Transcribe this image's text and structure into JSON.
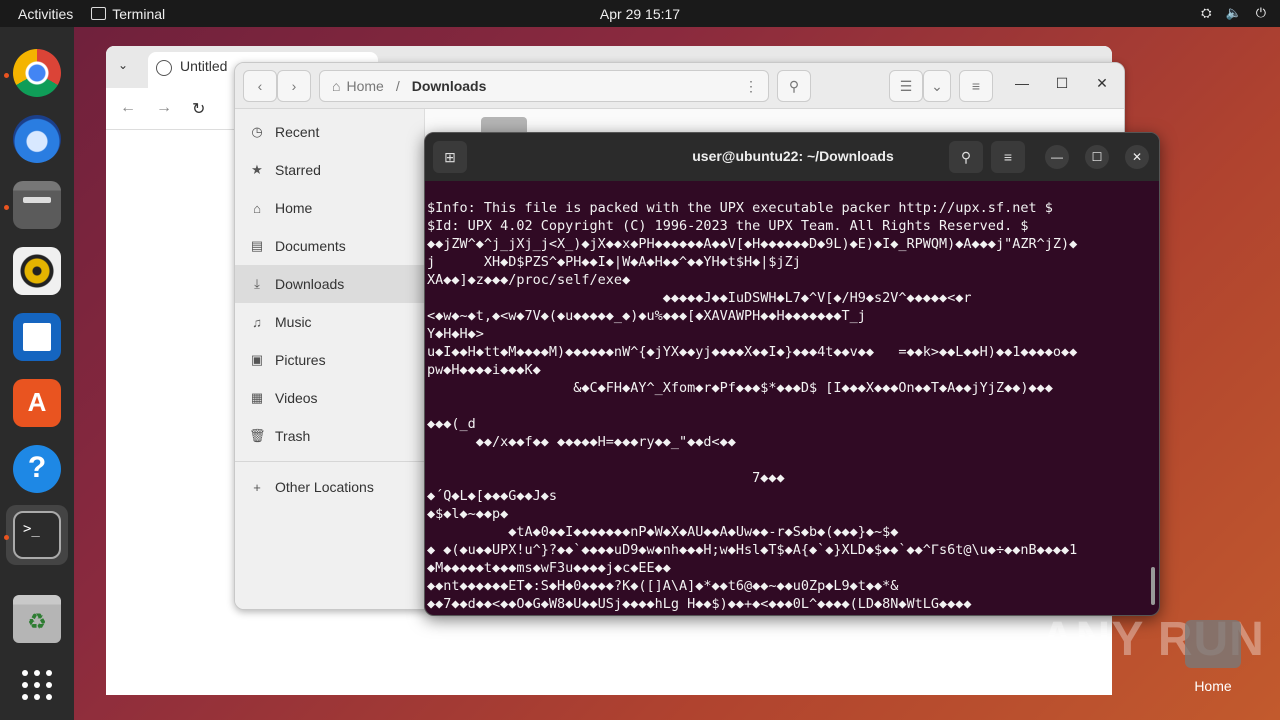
{
  "topbar": {
    "activities": "Activities",
    "app_name": "Terminal",
    "clock": "Apr 29  15:17"
  },
  "dock": {
    "items": [
      "Google Chrome",
      "Thunderbird",
      "Files",
      "Rhythmbox",
      "LibreOffice Writer",
      "Ubuntu Software",
      "Help",
      "Terminal",
      "Trash",
      "Show Applications"
    ]
  },
  "browser": {
    "tab_title": "Untitled"
  },
  "files": {
    "path_home": "Home",
    "path_sep": "/",
    "path_current": "Downloads",
    "sidebar": [
      {
        "label": "Recent",
        "icon": "clock-icon"
      },
      {
        "label": "Starred",
        "icon": "star-icon"
      },
      {
        "label": "Home",
        "icon": "home-icon"
      },
      {
        "label": "Documents",
        "icon": "document-icon"
      },
      {
        "label": "Downloads",
        "icon": "download-icon"
      },
      {
        "label": "Music",
        "icon": "music-icon"
      },
      {
        "label": "Pictures",
        "icon": "picture-icon"
      },
      {
        "label": "Videos",
        "icon": "video-icon"
      },
      {
        "label": "Trash",
        "icon": "trash-icon"
      }
    ],
    "other_locations": "Other Locations"
  },
  "terminal": {
    "title": "user@ubuntu22: ~/Downloads",
    "lines": [
      "$Info: This file is packed with the UPX executable packer http://upx.sf.net $",
      "$Id: UPX 4.02 Copyright (C) 1996-2023 the UPX Team. All Rights Reserved. $",
      "◆◆jZW^◆^j_jXj_j<X_)◆jX◆◆x◆PH◆◆◆◆◆◆A◆◆V[◆H◆◆◆◆◆◆D◆9L)◆E)◆I◆_RPWQM)◆A◆◆◆j\"AZR^jZ)◆",
      "j      XH◆D$PZS^◆PH◆◆I◆|W◆A◆H◆◆^◆◆YH◆t$H◆|$jZj",
      "XA◆◆]◆z◆◆◆/proc/self/exe◆",
      "                             ◆◆◆◆◆J◆◆IuDSWH◆L7◆^V[◆/H9◆s2V^◆◆◆◆◆<◆r",
      "<◆w◆~◆t,◆<w◆7V◆(◆u◆◆◆◆◆_◆)◆u%◆◆◆[◆XAVAWPH◆◆H◆◆◆◆◆◆◆T_j",
      "Y◆H◆H◆>",
      "u◆I◆◆H◆tt◆M◆◆◆◆M)◆◆◆◆◆◆nW^{◆jYX◆◆yj◆◆◆◆X◆◆I◆}◆◆◆4t◆◆v◆◆   =◆◆k>◆◆L◆◆H)◆◆1◆◆◆◆o◆◆",
      "pw◆H◆◆◆◆i◆◆◆K◆",
      "                  &◆C◆FH◆AY^_Xfom◆r◆Pf◆◆◆$*◆◆◆D$ [I◆◆◆X◆◆◆On◆◆T◆A◆◆jYjZ◆◆)◆◆◆",
      "",
      "◆◆◆(_d",
      "      ◆◆/x◆◆f◆◆ ◆◆◆◆◆H=◆◆◆ry◆◆_\"◆◆d<◆◆",
      "",
      "                                        7◆◆◆",
      "◆´Q◆L◆[◆◆◆G◆◆J◆s",
      "◆$◆l◆~◆◆p◆",
      "          ◆tA◆0◆◆I◆◆◆◆◆◆◆nP◆W◆X◆AU◆◆A◆Uw◆◆-r◆S◆b◆(◆◆◆}◆~$◆",
      "◆ ◆(◆u◆◆UPX!u^}?◆◆`◆◆◆◆uD9◆w◆nh◆◆◆H;w◆Hsl◆T$◆A{◆`◆}XLD◆$◆◆`◆◆^Γs6t@\\u◆÷◆◆nB◆◆◆◆1",
      "◆M◆◆◆◆◆t◆◆◆ms◆wF3u◆◆◆◆j◆c◆EE◆◆",
      "◆◆nt◆◆◆◆◆◆ET◆:S◆H◆0◆◆◆◆?K◆([]A\\A]◆*◆◆t6@◆◆~◆◆u0Zp◆L9◆t◆◆*&",
      "◆◆7◆◆d◆◆<◆◆O◆G◆W8◆U◆◆USj◆◆◆◆hLg H◆◆$)◆◆+◆<◆◆◆0L^◆◆◆◆(LD◆8N◆WtLG◆◆◆◆"
    ]
  },
  "watermark": "ANY RUN",
  "desktop_home_label": "Home"
}
